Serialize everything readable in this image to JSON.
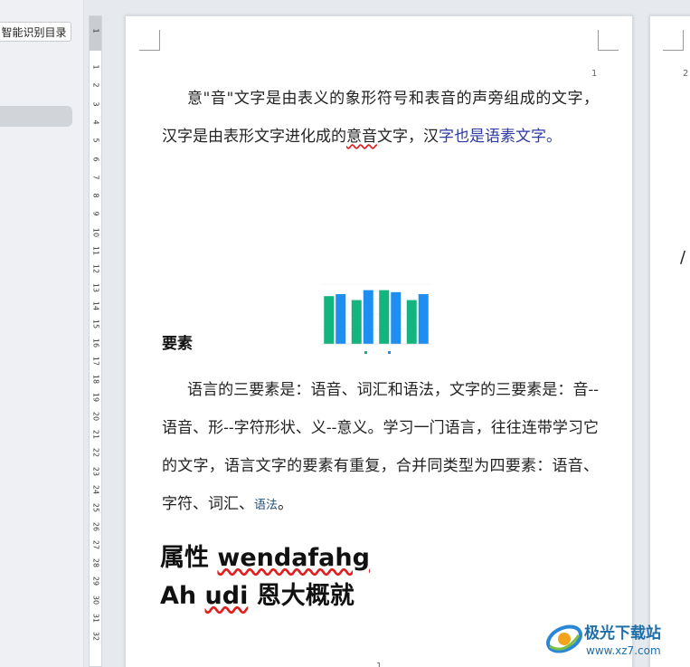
{
  "nav": {
    "toc_button": "智能识别目录"
  },
  "ruler": {
    "numbers": [
      "1",
      "1",
      "2",
      "3",
      "4",
      "5",
      "6",
      "7",
      "8",
      "9",
      "10",
      "11",
      "12",
      "13",
      "14",
      "15",
      "16",
      "17",
      "18",
      "19",
      "20",
      "21",
      "22",
      "23",
      "24",
      "25",
      "26",
      "27",
      "28",
      "29",
      "30",
      "31",
      "32"
    ]
  },
  "page1": {
    "page_number_top": "1",
    "para1": {
      "text_a": "意\"音\"文字是由表义的象形符号和表音的声旁组成的文字，汉字是由表形文字进化成的",
      "text_wavy": "意音",
      "text_b": "文字，汉",
      "text_blue": "字也是语素文字。"
    },
    "heading_section": "要素",
    "para2": {
      "text": "语言的三要素是：语音、词汇和语法，文字的三要素是：音--语音、形--字符形状、义--意义。学习一门语言，往往连带学习它的文字，语言文字的要素有重复，合并同类型为四要素：语音、字符、词汇、",
      "text_blue": "语法",
      "text_end": "。"
    },
    "heading1": {
      "part_a": "属性 ",
      "part_wavy": "wendafahg"
    },
    "heading2": {
      "part_a": "Ah ",
      "part_wavy": "udi",
      "part_b": " 恩大概就"
    },
    "page_number_bottom": "1"
  },
  "page2": {
    "page_number_top": "2",
    "fragment": "/"
  },
  "watermark": {
    "title": "极光下载站",
    "url": "www.xz7.com"
  },
  "colors": {
    "bar_green": "#13b47d",
    "bar_blue": "#1e8ef0"
  },
  "chart_data": {
    "type": "bar",
    "categories": [
      "",
      "",
      "",
      ""
    ],
    "series": [
      {
        "name": "",
        "values": [
          120,
          110,
          135,
          110
        ]
      },
      {
        "name": "",
        "values": [
          125,
          135,
          130,
          125
        ]
      }
    ],
    "ylim": [
      0,
      150
    ],
    "title": "",
    "xlabel": "",
    "ylabel": "",
    "legend": "bottom"
  }
}
